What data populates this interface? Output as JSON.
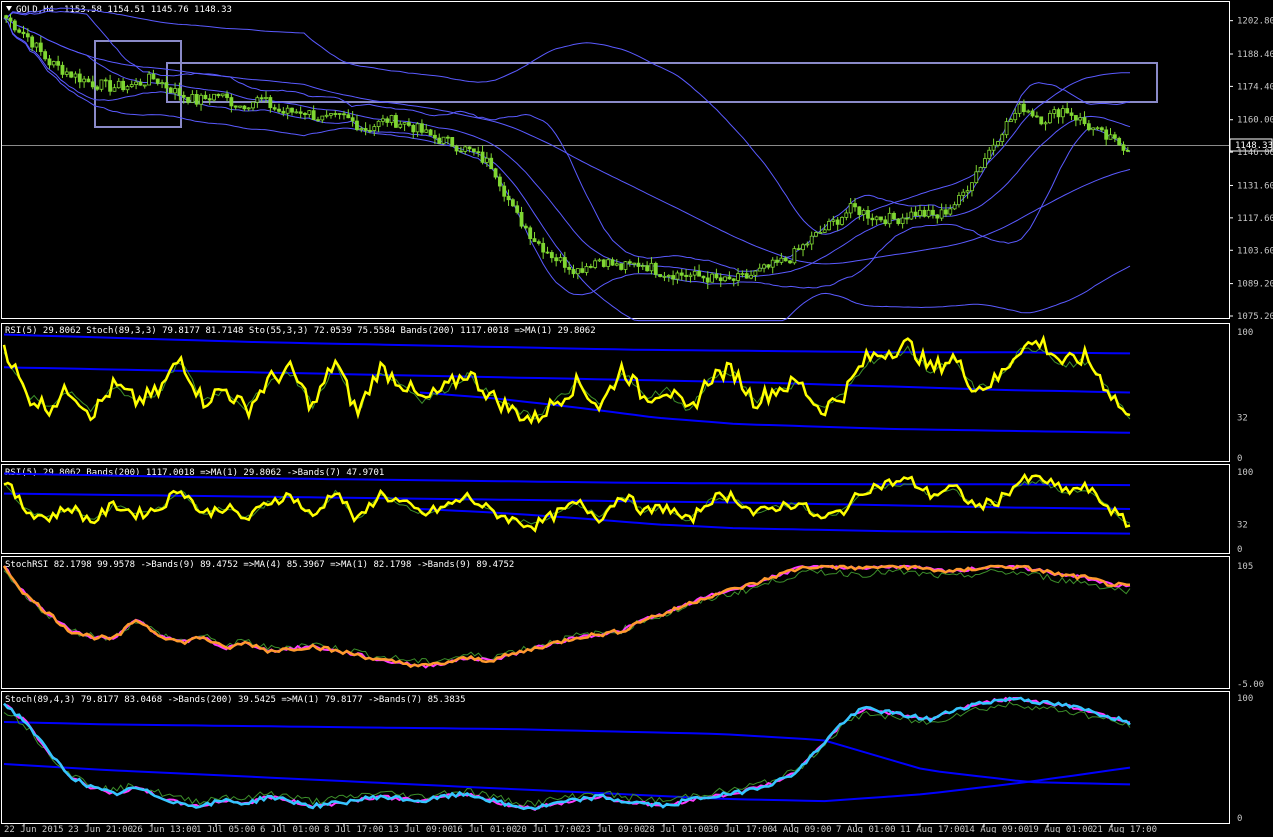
{
  "window": {
    "symbol_header": "GOLD,H4",
    "ohlc_readout": "1153.58 1154.51 1145.76 1148.33",
    "last_price_label": "1148.33"
  },
  "panels": [
    {
      "id": "price",
      "title": ""
    },
    {
      "id": "rsi_stoch",
      "title": "RSI(5) 29.8062  Stoch(89,3,3) 79.8177 81.7148  Sto(55,3,3) 72.0539 75.5584  Bands(200) 1117.0018  =>MA(1) 29.8062"
    },
    {
      "id": "rsi_bands",
      "title": "RSI(5) 29.8062  Bands(200) 1117.0018  =>MA(1) 29.8062  ->Bands(7) 47.9701"
    },
    {
      "id": "stochrsi",
      "title": "StochRSI 82.1798 99.9578  ->Bands(9) 89.4752  =>MA(4) 85.3967  =>MA(1) 82.1798  ->Bands(9) 89.4752"
    },
    {
      "id": "stoch",
      "title": "Stoch(89,4,3) 79.8177 83.0468  ->Bands(200) 39.5425  =>MA(1) 79.8177  ->Bands(7) 85.3835"
    }
  ],
  "colors": {
    "background": "#000000",
    "grid": "#ffffff",
    "candles": "#7fd632",
    "bands_thin": "#5a5aff",
    "bands_thick": "#0000ff",
    "rsi_line": "#ffff00",
    "stochrsi_orange": "#ff9a2e",
    "stochrsi_magenta": "#ff3cff",
    "stoch_cyan": "#35c6ff",
    "boxes": "#8a8ac8"
  },
  "chart_data": [
    {
      "type": "candlestick",
      "panel": "price",
      "ylim": [
        1075.2,
        1210
      ],
      "y_ticks": [
        1202.8,
        1188.4,
        1174.4,
        1160.0,
        1146.0,
        1131.6,
        1117.6,
        1103.6,
        1089.2,
        1075.2
      ],
      "x_labels": [
        "22 Jun 2015",
        "23 Jun 21:00",
        "26 Jun 13:00",
        "1 Jul 05:00",
        "6 Jul 01:00",
        "8 Jul 17:00",
        "13 Jul 09:00",
        "16 Jul 01:00",
        "20 Jul 17:00",
        "23 Jul 09:00",
        "28 Jul 01:00",
        "30 Jul 17:00",
        "4 Aug 09:00",
        "7 Aug 01:00",
        "11 Aug 17:00",
        "14 Aug 09:00",
        "19 Aug 01:00",
        "21 Aug 17:00"
      ],
      "close_path": [
        1204,
        1196,
        1185,
        1180,
        1176,
        1174,
        1175,
        1178,
        1172,
        1168,
        1171,
        1166,
        1169,
        1163,
        1164,
        1160,
        1161,
        1156,
        1160,
        1158,
        1153,
        1150,
        1146,
        1140,
        1120,
        1108,
        1100,
        1095,
        1100,
        1096,
        1098,
        1094,
        1093,
        1092,
        1090,
        1092,
        1096,
        1100,
        1108,
        1115,
        1122,
        1118,
        1117,
        1120,
        1118,
        1125,
        1140,
        1155,
        1166,
        1160,
        1165,
        1158,
        1152,
        1148
      ]
    },
    {
      "type": "line",
      "panel": "rsi_stoch",
      "ylim": [
        0,
        100
      ],
      "y_ticks": [
        100,
        32,
        0
      ],
      "series": [
        {
          "name": "RSI(5)",
          "values": [
            90,
            50,
            40,
            55,
            35,
            58,
            45,
            52,
            80,
            45,
            55,
            38,
            62,
            70,
            40,
            78,
            35,
            72,
            60,
            45,
            55,
            68,
            50,
            38,
            30,
            45,
            60,
            40,
            72,
            48,
            55,
            35,
            65,
            70,
            45,
            55,
            60,
            38,
            50,
            78,
            85,
            90,
            70,
            80,
            55,
            62,
            88,
            92,
            75,
            80,
            55,
            29.8
          ]
        }
      ]
    },
    {
      "type": "line",
      "panel": "rsi_bands",
      "ylim": [
        0,
        100
      ],
      "y_ticks": [
        100,
        32,
        0
      ],
      "series": [
        {
          "name": "RSI(5)",
          "values": [
            90,
            50,
            40,
            55,
            35,
            58,
            45,
            52,
            80,
            45,
            55,
            38,
            62,
            70,
            40,
            78,
            35,
            72,
            60,
            45,
            55,
            68,
            50,
            38,
            30,
            45,
            60,
            40,
            72,
            48,
            55,
            35,
            65,
            70,
            45,
            55,
            60,
            38,
            50,
            78,
            85,
            90,
            70,
            80,
            55,
            62,
            88,
            92,
            75,
            80,
            55,
            29.8
          ]
        }
      ]
    },
    {
      "type": "line",
      "panel": "stochrsi",
      "y_ticks": [
        "105",
        "-5.00"
      ],
      "series": [
        {
          "name": "StochRSI",
          "values": [
            100,
            75,
            60,
            45,
            40,
            38,
            55,
            42,
            35,
            40,
            30,
            35,
            28,
            30,
            32,
            28,
            25,
            20,
            18,
            15,
            18,
            22,
            20,
            25,
            30,
            35,
            40,
            42,
            45,
            55,
            60,
            68,
            75,
            80,
            85,
            92,
            98,
            100,
            99,
            98,
            100,
            99,
            97,
            95,
            98,
            100,
            99,
            96,
            92,
            90,
            85,
            82.2
          ]
        }
      ]
    },
    {
      "type": "line",
      "panel": "stoch",
      "y_ticks": [
        100,
        0
      ],
      "series": [
        {
          "name": "Stoch(89,4,3)",
          "values": [
            95,
            80,
            55,
            35,
            25,
            20,
            25,
            18,
            12,
            10,
            15,
            12,
            18,
            14,
            10,
            12,
            15,
            18,
            16,
            14,
            18,
            20,
            15,
            10,
            8,
            12,
            15,
            18,
            14,
            12,
            10,
            15,
            18,
            20,
            25,
            30,
            40,
            60,
            80,
            92,
            88,
            85,
            82,
            90,
            95,
            98,
            100,
            96,
            94,
            90,
            85,
            79.8
          ]
        }
      ]
    }
  ]
}
